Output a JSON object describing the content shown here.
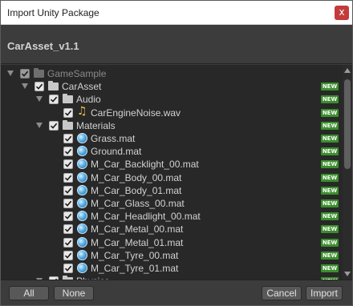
{
  "window": {
    "title": "Import Unity Package",
    "close_glyph": "x"
  },
  "header": {
    "package_name": "CarAsset_v1.1"
  },
  "new_badge": "NEW",
  "tree": [
    {
      "label": "GameSample",
      "icon": "folder-icon",
      "depth": 0,
      "expanded": true,
      "checked": true,
      "dimmed": true,
      "is_new": false
    },
    {
      "label": "CarAsset",
      "icon": "folder-icon",
      "depth": 1,
      "expanded": true,
      "checked": true,
      "dimmed": false,
      "is_new": true
    },
    {
      "label": "Audio",
      "icon": "folder-icon",
      "depth": 2,
      "expanded": true,
      "checked": true,
      "dimmed": false,
      "is_new": true
    },
    {
      "label": "CarEngineNoise.wav",
      "icon": "audio-file-icon",
      "depth": 3,
      "expanded": false,
      "checked": true,
      "dimmed": false,
      "is_new": true
    },
    {
      "label": "Materials",
      "icon": "folder-icon",
      "depth": 2,
      "expanded": true,
      "checked": true,
      "dimmed": false,
      "is_new": true
    },
    {
      "label": "Grass.mat",
      "icon": "material-icon",
      "depth": 3,
      "expanded": false,
      "checked": true,
      "dimmed": false,
      "is_new": true
    },
    {
      "label": "Ground.mat",
      "icon": "material-icon",
      "depth": 3,
      "expanded": false,
      "checked": true,
      "dimmed": false,
      "is_new": true
    },
    {
      "label": "M_Car_Backlight_00.mat",
      "icon": "material-icon",
      "depth": 3,
      "expanded": false,
      "checked": true,
      "dimmed": false,
      "is_new": true
    },
    {
      "label": "M_Car_Body_00.mat",
      "icon": "material-icon",
      "depth": 3,
      "expanded": false,
      "checked": true,
      "dimmed": false,
      "is_new": true
    },
    {
      "label": "M_Car_Body_01.mat",
      "icon": "material-icon",
      "depth": 3,
      "expanded": false,
      "checked": true,
      "dimmed": false,
      "is_new": true
    },
    {
      "label": "M_Car_Glass_00.mat",
      "icon": "material-icon",
      "depth": 3,
      "expanded": false,
      "checked": true,
      "dimmed": false,
      "is_new": true
    },
    {
      "label": "M_Car_Headlight_00.mat",
      "icon": "material-icon",
      "depth": 3,
      "expanded": false,
      "checked": true,
      "dimmed": false,
      "is_new": true
    },
    {
      "label": "M_Car_Metal_00.mat",
      "icon": "material-icon",
      "depth": 3,
      "expanded": false,
      "checked": true,
      "dimmed": false,
      "is_new": true
    },
    {
      "label": "M_Car_Metal_01.mat",
      "icon": "material-icon",
      "depth": 3,
      "expanded": false,
      "checked": true,
      "dimmed": false,
      "is_new": true
    },
    {
      "label": "M_Car_Tyre_00.mat",
      "icon": "material-icon",
      "depth": 3,
      "expanded": false,
      "checked": true,
      "dimmed": false,
      "is_new": true
    },
    {
      "label": "M_Car_Tyre_01.mat",
      "icon": "material-icon",
      "depth": 3,
      "expanded": false,
      "checked": true,
      "dimmed": false,
      "is_new": true
    },
    {
      "label": "Physics",
      "icon": "folder-icon",
      "depth": 2,
      "expanded": true,
      "checked": true,
      "dimmed": false,
      "is_new": true
    }
  ],
  "footer": {
    "all_label": "All",
    "none_label": "None",
    "cancel_label": "Cancel",
    "import_label": "Import"
  },
  "colors": {
    "new_badge": "#3a8e2c",
    "tree_background": "#282828",
    "panel_background": "#3c3c3c",
    "close_button": "#c43b3b",
    "audio_icon": "#e8c24a",
    "material_icon": "#5ab0e6"
  }
}
